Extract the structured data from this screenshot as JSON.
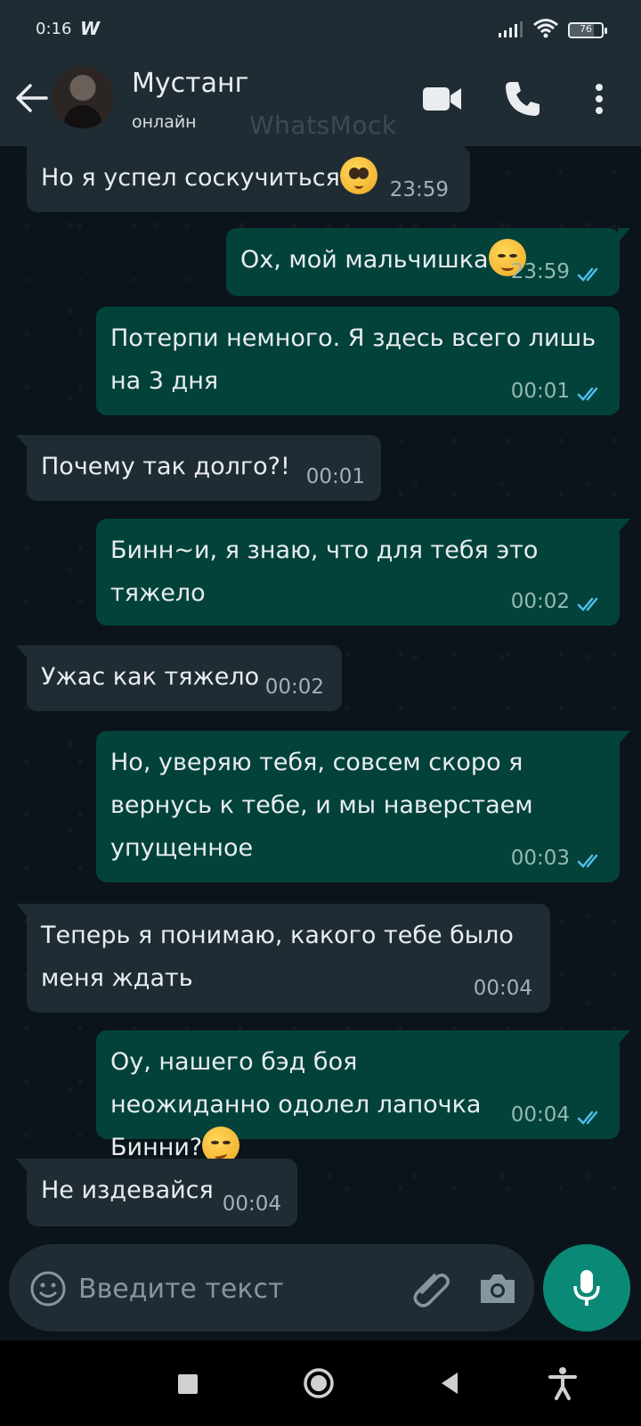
{
  "status_bar": {
    "time": "0:16",
    "app_indicator": "W",
    "battery": "76"
  },
  "header": {
    "contact_name": "Мустанг",
    "contact_status": "онлайн",
    "watermark": "WhatsMock",
    "icons": [
      "back-arrow-icon",
      "video-call-icon",
      "phone-call-icon",
      "more-vert-icon"
    ]
  },
  "messages": [
    {
      "dir": "in",
      "text": "Но я успел соскучиться",
      "emoji": "pleading-face",
      "time": "23:59"
    },
    {
      "dir": "out",
      "text": "Ох, мой мальчишка",
      "emoji": "smiling-face",
      "time": "23:59",
      "read": true
    },
    {
      "dir": "out",
      "text": "Потерпи немного. Я здесь всего лишь на 3 дня",
      "time": "00:01",
      "read": true
    },
    {
      "dir": "in",
      "text": "Почему так долго?!",
      "time": "00:01"
    },
    {
      "dir": "out",
      "text": "Бинн~и, я знаю, что для тебя это тяжело",
      "time": "00:02",
      "read": true
    },
    {
      "dir": "in",
      "text": "Ужас как тяжело",
      "time": "00:02"
    },
    {
      "dir": "out",
      "text": "Но, уверяю тебя, совсем скоро я вернусь к тебе, и мы наверстаем упущенное",
      "time": "00:03",
      "read": true
    },
    {
      "dir": "in",
      "text": "Теперь я понимаю, какого тебе было меня ждать",
      "time": "00:04"
    },
    {
      "dir": "out",
      "text": "Оу, нашего бэд боя неожиданно одолел лапочка Бинни?",
      "emoji": "smirking-face",
      "time": "00:04",
      "read": true
    },
    {
      "dir": "in",
      "text": "Не издевайся",
      "time": "00:04"
    }
  ],
  "input": {
    "placeholder": "Введите текст"
  },
  "colors": {
    "background": "#0b141a",
    "incoming_bubble": "#1f2c34",
    "outgoing_bubble": "#02423a",
    "accent": "#0a8a76",
    "read_ticks": "#53bdeb"
  }
}
